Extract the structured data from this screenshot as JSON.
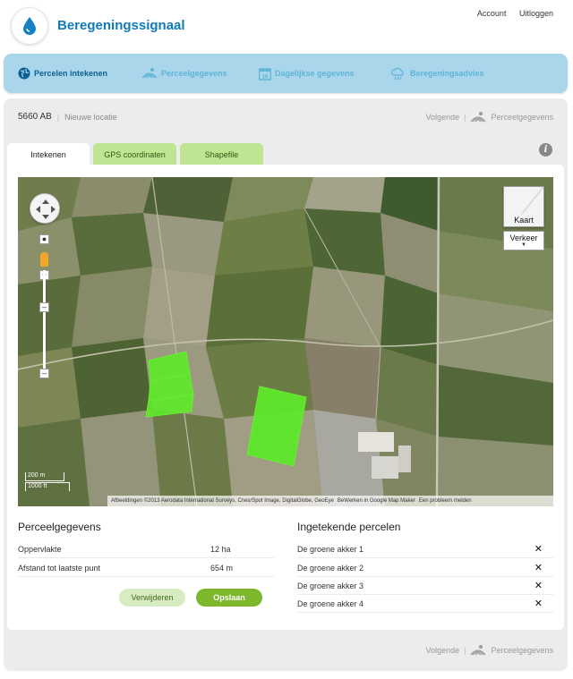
{
  "header": {
    "title": "Beregeningssignaal",
    "account": "Account",
    "logout": "Uitloggen",
    "logo_icon": "water-drop-icon"
  },
  "nav": {
    "items": [
      {
        "label": "Percelen intekenen",
        "icon": "globe-icon",
        "active": true
      },
      {
        "label": "Perceelgegevens",
        "icon": "field-rows-icon",
        "active": false
      },
      {
        "label": "Dagelijkse gegevens",
        "icon": "calendar-icon",
        "active": false
      },
      {
        "label": "Beregeningsadvies",
        "icon": "rain-cloud-icon",
        "active": false
      }
    ]
  },
  "location": {
    "postcode": "5660 AB",
    "new_location": "Nieuwe locatie"
  },
  "next": {
    "label": "Volgende",
    "target": "Perceelgegevens"
  },
  "tabs": [
    {
      "label": "Intekenen",
      "active": true
    },
    {
      "label": "GPS coordinaten",
      "active": false
    },
    {
      "label": "Shapefile",
      "active": false
    }
  ],
  "map": {
    "maptype_label": "Kaart",
    "traffic_label": "Verkeer",
    "scale_metric": "200 m",
    "scale_imperial": "1000 ft",
    "attribution": "Afbeeldingen ©2013 Aerodata International Surveys, Cnes/Spot Image, DigitalGlobe, GeoEye",
    "report_link": "BeWerken in Google Map Maker",
    "problem_link": "Een probleem melden"
  },
  "parcel_info": {
    "title": "Perceelgegevens",
    "rows": [
      {
        "label": "Oppervlakte",
        "value": "12 ha"
      },
      {
        "label": "Afstand tot laatste punt",
        "value": "654 m"
      }
    ],
    "delete_label": "Verwijderen",
    "save_label": "Opslaan"
  },
  "drawn_parcels": {
    "title": "Ingetekende percelen",
    "items": [
      {
        "name": "De groene akker 1"
      },
      {
        "name": "De groene akker 2"
      },
      {
        "name": "De groene akker 3"
      },
      {
        "name": "De groene akker 4"
      }
    ],
    "delete_glyph": "✕"
  },
  "colors": {
    "brand": "#0f7bb8",
    "nav_bg": "#a9d6ea",
    "accent_green": "#7db72b",
    "parcel_fill": "#5ee82a"
  }
}
